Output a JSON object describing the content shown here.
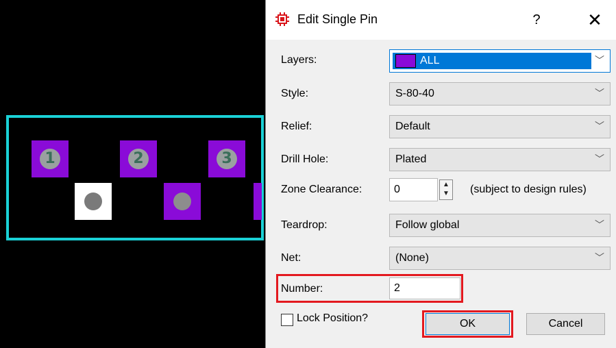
{
  "canvas": {
    "pads": [
      {
        "number": "1"
      },
      {
        "number": "2"
      },
      {
        "number": "3"
      }
    ]
  },
  "dialog": {
    "title": "Edit Single Pin",
    "help_label": "?",
    "close_label": "✕",
    "fields": {
      "layers": {
        "label": "Layers:",
        "value": "ALL",
        "swatch_color": "#8a0bd8"
      },
      "style": {
        "label": "Style:",
        "value": "S-80-40"
      },
      "relief": {
        "label": "Relief:",
        "value": "Default"
      },
      "drill_hole": {
        "label": "Drill Hole:",
        "value": "Plated"
      },
      "zone_clearance": {
        "label": "Zone Clearance:",
        "value": "0",
        "note": "(subject to design rules)"
      },
      "teardrop": {
        "label": "Teardrop:",
        "value": "Follow global"
      },
      "net": {
        "label": "Net:",
        "value": "(None)"
      },
      "number": {
        "label": "Number:",
        "value": "2"
      }
    },
    "lock_position_label": "Lock Position?",
    "ok_label": "OK",
    "cancel_label": "Cancel"
  },
  "colors": {
    "pad": "#8a0bd8",
    "board_outline": "#1ad1d6",
    "highlight_box": "#e3191f",
    "selection": "#0078d7"
  }
}
